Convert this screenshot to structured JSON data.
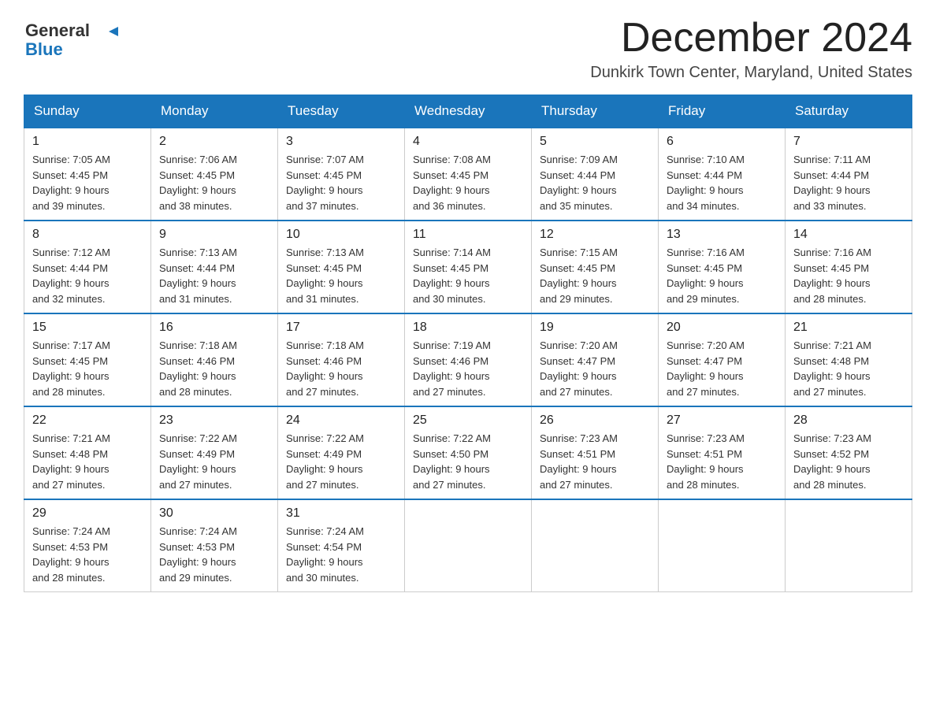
{
  "logo": {
    "text_general": "General",
    "text_blue": "Blue"
  },
  "title": "December 2024",
  "subtitle": "Dunkirk Town Center, Maryland, United States",
  "weekdays": [
    "Sunday",
    "Monday",
    "Tuesday",
    "Wednesday",
    "Thursday",
    "Friday",
    "Saturday"
  ],
  "weeks": [
    [
      {
        "day": "1",
        "sunrise": "7:05 AM",
        "sunset": "4:45 PM",
        "daylight": "9 hours and 39 minutes."
      },
      {
        "day": "2",
        "sunrise": "7:06 AM",
        "sunset": "4:45 PM",
        "daylight": "9 hours and 38 minutes."
      },
      {
        "day": "3",
        "sunrise": "7:07 AM",
        "sunset": "4:45 PM",
        "daylight": "9 hours and 37 minutes."
      },
      {
        "day": "4",
        "sunrise": "7:08 AM",
        "sunset": "4:45 PM",
        "daylight": "9 hours and 36 minutes."
      },
      {
        "day": "5",
        "sunrise": "7:09 AM",
        "sunset": "4:44 PM",
        "daylight": "9 hours and 35 minutes."
      },
      {
        "day": "6",
        "sunrise": "7:10 AM",
        "sunset": "4:44 PM",
        "daylight": "9 hours and 34 minutes."
      },
      {
        "day": "7",
        "sunrise": "7:11 AM",
        "sunset": "4:44 PM",
        "daylight": "9 hours and 33 minutes."
      }
    ],
    [
      {
        "day": "8",
        "sunrise": "7:12 AM",
        "sunset": "4:44 PM",
        "daylight": "9 hours and 32 minutes."
      },
      {
        "day": "9",
        "sunrise": "7:13 AM",
        "sunset": "4:44 PM",
        "daylight": "9 hours and 31 minutes."
      },
      {
        "day": "10",
        "sunrise": "7:13 AM",
        "sunset": "4:45 PM",
        "daylight": "9 hours and 31 minutes."
      },
      {
        "day": "11",
        "sunrise": "7:14 AM",
        "sunset": "4:45 PM",
        "daylight": "9 hours and 30 minutes."
      },
      {
        "day": "12",
        "sunrise": "7:15 AM",
        "sunset": "4:45 PM",
        "daylight": "9 hours and 29 minutes."
      },
      {
        "day": "13",
        "sunrise": "7:16 AM",
        "sunset": "4:45 PM",
        "daylight": "9 hours and 29 minutes."
      },
      {
        "day": "14",
        "sunrise": "7:16 AM",
        "sunset": "4:45 PM",
        "daylight": "9 hours and 28 minutes."
      }
    ],
    [
      {
        "day": "15",
        "sunrise": "7:17 AM",
        "sunset": "4:45 PM",
        "daylight": "9 hours and 28 minutes."
      },
      {
        "day": "16",
        "sunrise": "7:18 AM",
        "sunset": "4:46 PM",
        "daylight": "9 hours and 28 minutes."
      },
      {
        "day": "17",
        "sunrise": "7:18 AM",
        "sunset": "4:46 PM",
        "daylight": "9 hours and 27 minutes."
      },
      {
        "day": "18",
        "sunrise": "7:19 AM",
        "sunset": "4:46 PM",
        "daylight": "9 hours and 27 minutes."
      },
      {
        "day": "19",
        "sunrise": "7:20 AM",
        "sunset": "4:47 PM",
        "daylight": "9 hours and 27 minutes."
      },
      {
        "day": "20",
        "sunrise": "7:20 AM",
        "sunset": "4:47 PM",
        "daylight": "9 hours and 27 minutes."
      },
      {
        "day": "21",
        "sunrise": "7:21 AM",
        "sunset": "4:48 PM",
        "daylight": "9 hours and 27 minutes."
      }
    ],
    [
      {
        "day": "22",
        "sunrise": "7:21 AM",
        "sunset": "4:48 PM",
        "daylight": "9 hours and 27 minutes."
      },
      {
        "day": "23",
        "sunrise": "7:22 AM",
        "sunset": "4:49 PM",
        "daylight": "9 hours and 27 minutes."
      },
      {
        "day": "24",
        "sunrise": "7:22 AM",
        "sunset": "4:49 PM",
        "daylight": "9 hours and 27 minutes."
      },
      {
        "day": "25",
        "sunrise": "7:22 AM",
        "sunset": "4:50 PM",
        "daylight": "9 hours and 27 minutes."
      },
      {
        "day": "26",
        "sunrise": "7:23 AM",
        "sunset": "4:51 PM",
        "daylight": "9 hours and 27 minutes."
      },
      {
        "day": "27",
        "sunrise": "7:23 AM",
        "sunset": "4:51 PM",
        "daylight": "9 hours and 28 minutes."
      },
      {
        "day": "28",
        "sunrise": "7:23 AM",
        "sunset": "4:52 PM",
        "daylight": "9 hours and 28 minutes."
      }
    ],
    [
      {
        "day": "29",
        "sunrise": "7:24 AM",
        "sunset": "4:53 PM",
        "daylight": "9 hours and 28 minutes."
      },
      {
        "day": "30",
        "sunrise": "7:24 AM",
        "sunset": "4:53 PM",
        "daylight": "9 hours and 29 minutes."
      },
      {
        "day": "31",
        "sunrise": "7:24 AM",
        "sunset": "4:54 PM",
        "daylight": "9 hours and 30 minutes."
      },
      null,
      null,
      null,
      null
    ]
  ],
  "labels": {
    "sunrise": "Sunrise:",
    "sunset": "Sunset:",
    "daylight": "Daylight:"
  },
  "accent_color": "#1a75bb"
}
